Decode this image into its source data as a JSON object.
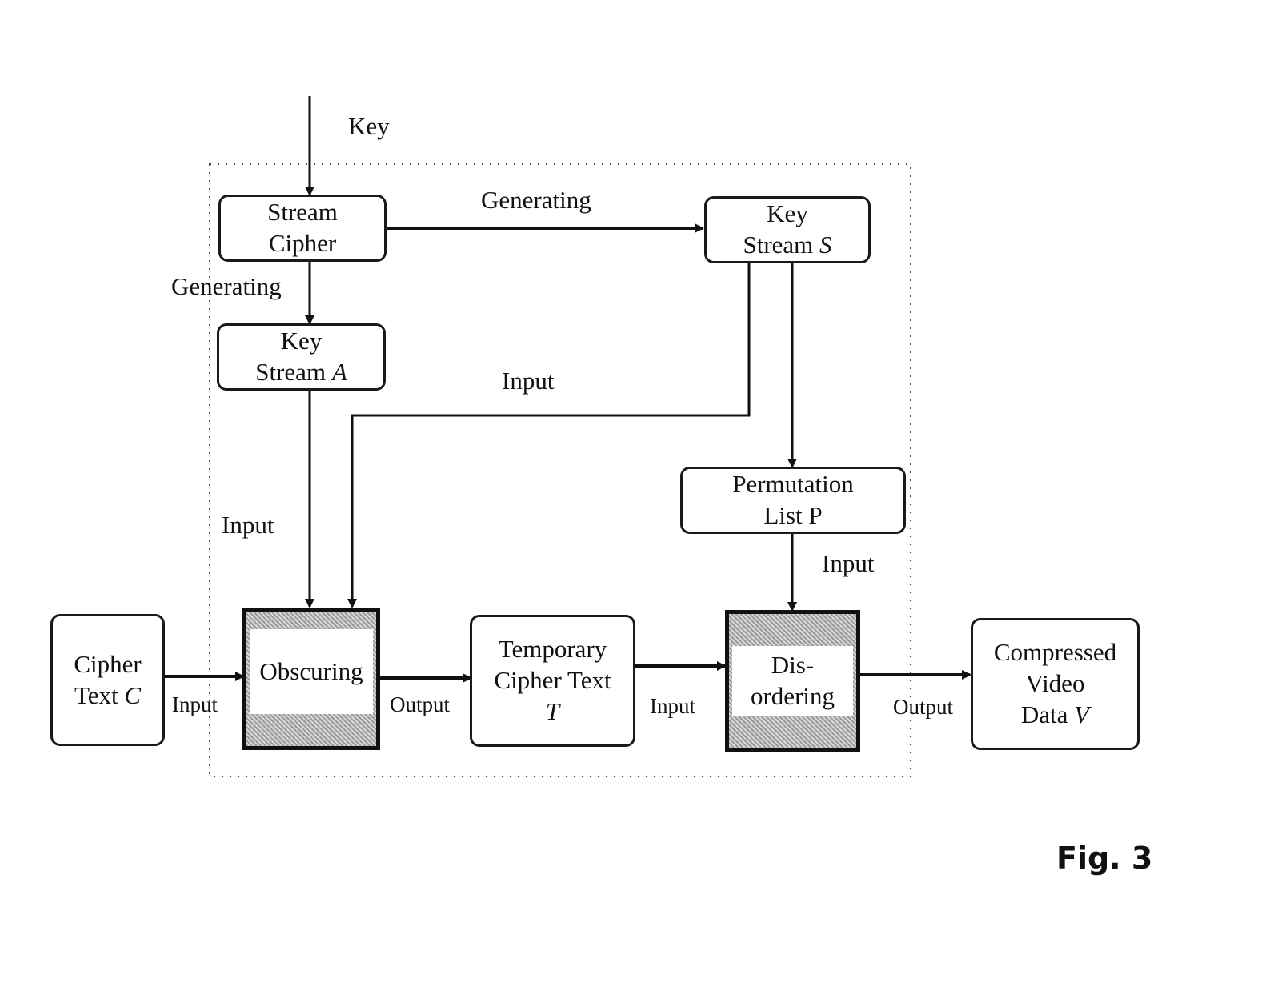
{
  "boxes": {
    "stream_cipher": {
      "line1": "Stream",
      "line2": "Cipher"
    },
    "key_stream_s": {
      "line1": "Key",
      "line2": "Stream",
      "var": "S"
    },
    "key_stream_a": {
      "line1": "Key",
      "line2": "Stream",
      "var": "A"
    },
    "permutation_list": {
      "line1": "Permutation",
      "line2": "List P"
    },
    "cipher_text": {
      "line1": "Cipher",
      "line2": "Text",
      "var": "C"
    },
    "obscuring": {
      "line1": "Obscuring"
    },
    "temporary_cipher_text": {
      "line1": "Temporary",
      "line2": "Cipher Text",
      "var": "T"
    },
    "disordering": {
      "line1": "Dis-",
      "line2": "ordering"
    },
    "compressed_video": {
      "line1": "Compressed",
      "line2": "Video",
      "line3": "Data",
      "var": "V"
    }
  },
  "labels": {
    "key": "Key",
    "generating_top": "Generating",
    "generating_left": "Generating",
    "input_middle": "Input",
    "input_left": "Input",
    "input_right": "Input",
    "input_cipher": "Input",
    "output_obscuring": "Output",
    "input_temporary": "Input",
    "output_disordering": "Output"
  },
  "figure_label": "Fig. 3"
}
